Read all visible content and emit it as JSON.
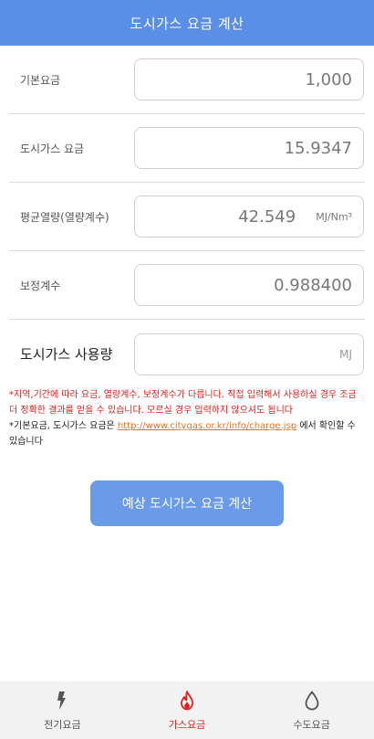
{
  "header": {
    "title": "도시가스 요금 계산"
  },
  "fields": [
    {
      "label": "기본요금",
      "value": "1,000",
      "unit": ""
    },
    {
      "label": "도시가스 요금",
      "value": "15.9347",
      "unit": ""
    },
    {
      "label": "평균열량(열량계수)",
      "value": "42.549",
      "unit": "MJ/Nm³"
    },
    {
      "label": "보정계수",
      "value": "0.988400",
      "unit": ""
    },
    {
      "label": "도시가스 사용량",
      "value": "",
      "placeholder": "MJ"
    }
  ],
  "notes": {
    "red_text": "*지역,기간에 따라 요금, 열량계수, 보정계수가 다릅니다. 직접 입력해서 사용하실 경우 조금 더 정확한 결과를 얻을 수 있습니다. 모르실 경우 입력하지 않으셔도 됩니다",
    "info_prefix": "*기본요금, 도시가스 요금은 ",
    "link": "http://www.citygas.or.kr/info/charge.jsp",
    "info_suffix": " 에서 확인할 수 있습니다"
  },
  "calculate_button": {
    "label": "예상 도시가스 요금 계산"
  },
  "bottom_nav": [
    {
      "label": "전기요금",
      "icon": "lightning-icon",
      "active": false
    },
    {
      "label": "가스요금",
      "icon": "flame-icon",
      "active": true
    },
    {
      "label": "수도요금",
      "icon": "water-drop-icon",
      "active": false
    }
  ],
  "colors": {
    "header": "#5b8ee6",
    "button": "#6a9ae8",
    "warning": "#e01b1b",
    "link": "#e6742b",
    "active_tab": "#e02020"
  }
}
